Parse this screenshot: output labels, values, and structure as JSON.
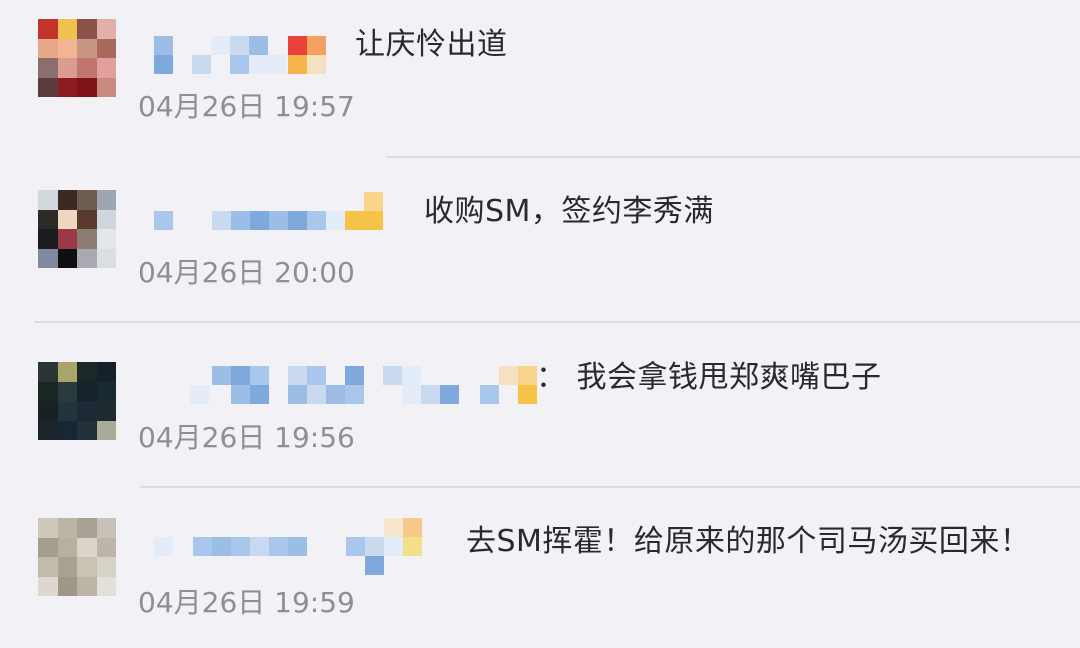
{
  "comments": [
    {
      "text": "让庆怜出道",
      "time": "04月26日 19:57"
    },
    {
      "text": "收购SM，签约李秀满",
      "time": "04月26日 20:00"
    },
    {
      "text": "：  我会拿钱甩郑爽嘴巴子",
      "time": "04月26日 19:56"
    },
    {
      "text": "去SM挥霍！给原来的那个司马汤买回来！",
      "time": "04月26日 19:59"
    }
  ],
  "colors": {
    "background": "#f1f1f6",
    "text": "#2a2a2e",
    "timestamp": "#8e8e96",
    "divider": "#dcdce3",
    "pixel_blue": "#7fa9dc",
    "pixel_light_blue": "#c9daf0",
    "pixel_gold": "#f5c24a"
  }
}
